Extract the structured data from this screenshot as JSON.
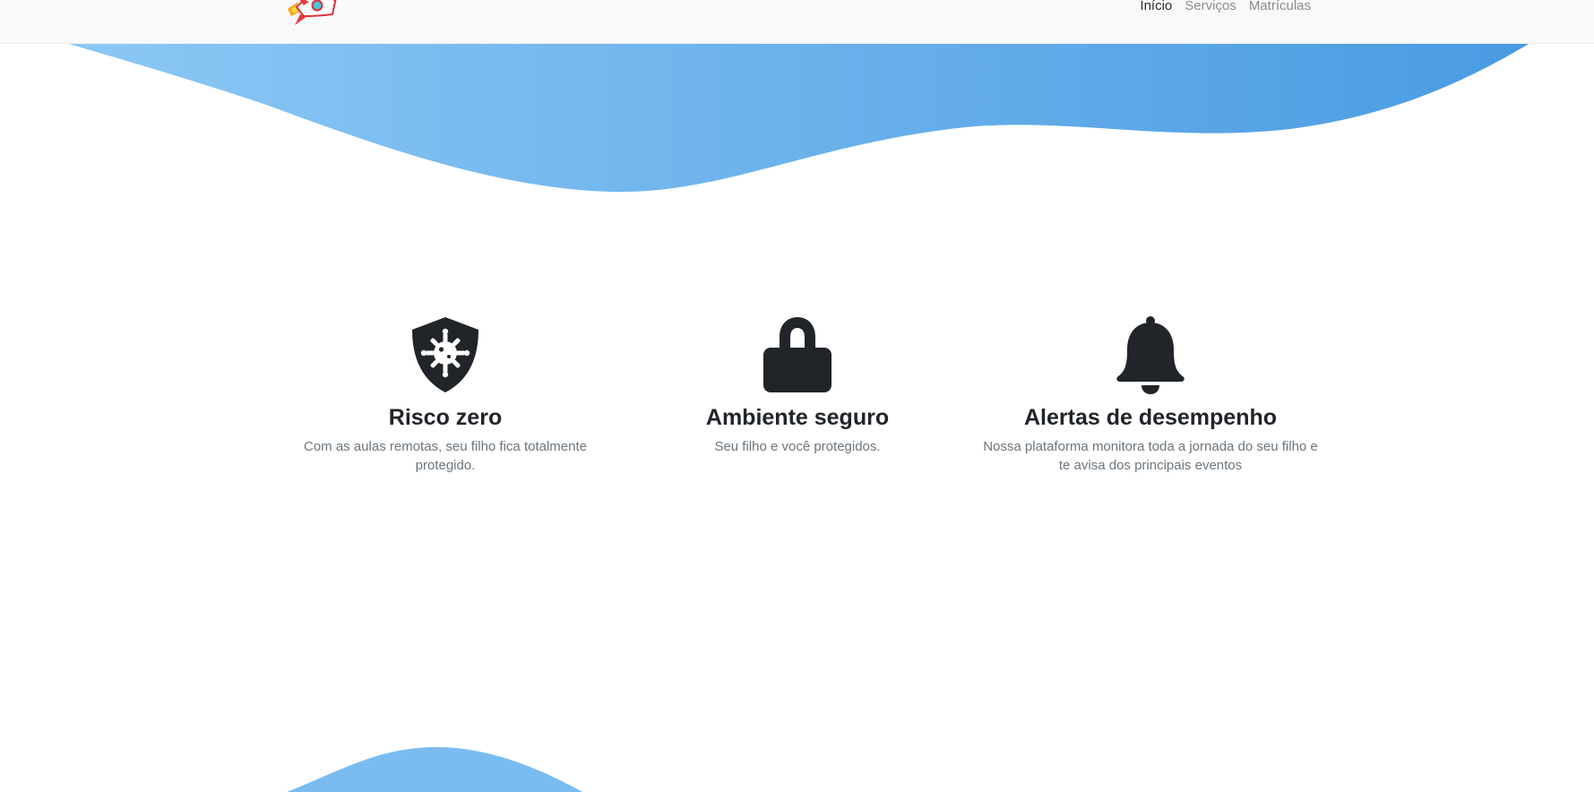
{
  "nav": {
    "links": [
      {
        "label": "Início",
        "active": true
      },
      {
        "label": "Serviços",
        "active": false
      },
      {
        "label": "Matrículas",
        "active": false
      }
    ],
    "logo_icon": "rocket-icon"
  },
  "colors": {
    "wave_light": "#8cc8f5",
    "wave_dark": "#4a9be2",
    "icon_dark": "#212529",
    "text_muted": "#6c757d",
    "navbar_bg": "#f8f9fa"
  },
  "features": [
    {
      "icon": "shield-virus-icon",
      "title": "Risco zero",
      "description": "Com as aulas remotas, seu filho fica totalmente protegido."
    },
    {
      "icon": "lock-icon",
      "title": "Ambiente seguro",
      "description": "Seu filho e você protegidos."
    },
    {
      "icon": "bell-icon",
      "title": "Alertas de desempenho",
      "description": "Nossa plataforma monitora toda a jornada do seu filho e te avisa dos principais eventos"
    }
  ]
}
